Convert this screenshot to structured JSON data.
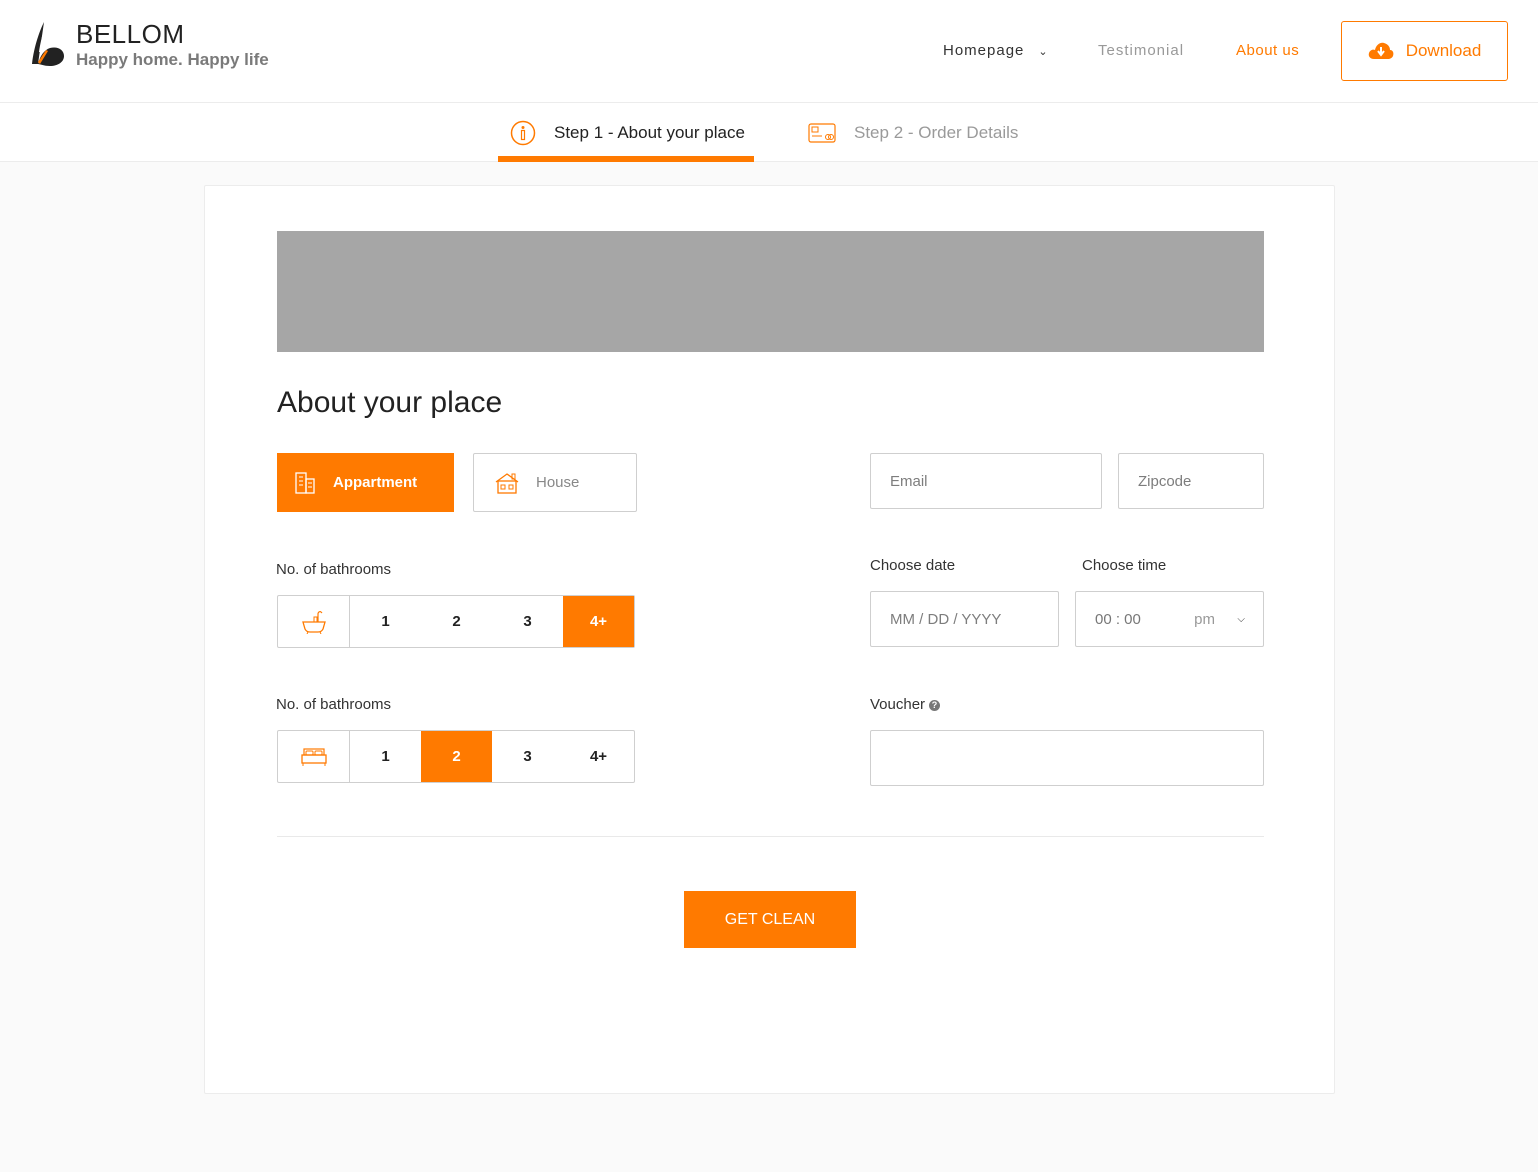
{
  "header": {
    "brand_name": "BELLOM",
    "tagline": "Happy home. Happy life",
    "nav": {
      "homepage": "Homepage",
      "testimonial": "Testimonial",
      "about": "About us"
    },
    "download_label": "Download"
  },
  "steps": {
    "step1": "Step 1 - About your place",
    "step2": "Step 2 - Order Details"
  },
  "form": {
    "title": "About your place",
    "types": {
      "apartment": "Appartment",
      "house": "House",
      "selected": "Appartment"
    },
    "bathrooms_label": "No. of bathrooms",
    "bathroom_options": [
      "1",
      "2",
      "3",
      "4+"
    ],
    "bathrooms_selected": "4+",
    "bedrooms_label": "No. of bathrooms",
    "bedroom_options": [
      "1",
      "2",
      "3",
      "4+"
    ],
    "bedrooms_selected": "2",
    "email_placeholder": "Email",
    "zipcode_placeholder": "Zipcode",
    "date_label": "Choose date",
    "time_label": "Choose time",
    "date_placeholder": "MM / DD / YYYY",
    "time_value": "00 : 00",
    "time_ampm": "pm",
    "voucher_label": "Voucher",
    "voucher_value": "",
    "submit_label": "GET CLEAN"
  },
  "colors": {
    "accent": "#ff7a00",
    "banner": "#a6a6a6"
  }
}
